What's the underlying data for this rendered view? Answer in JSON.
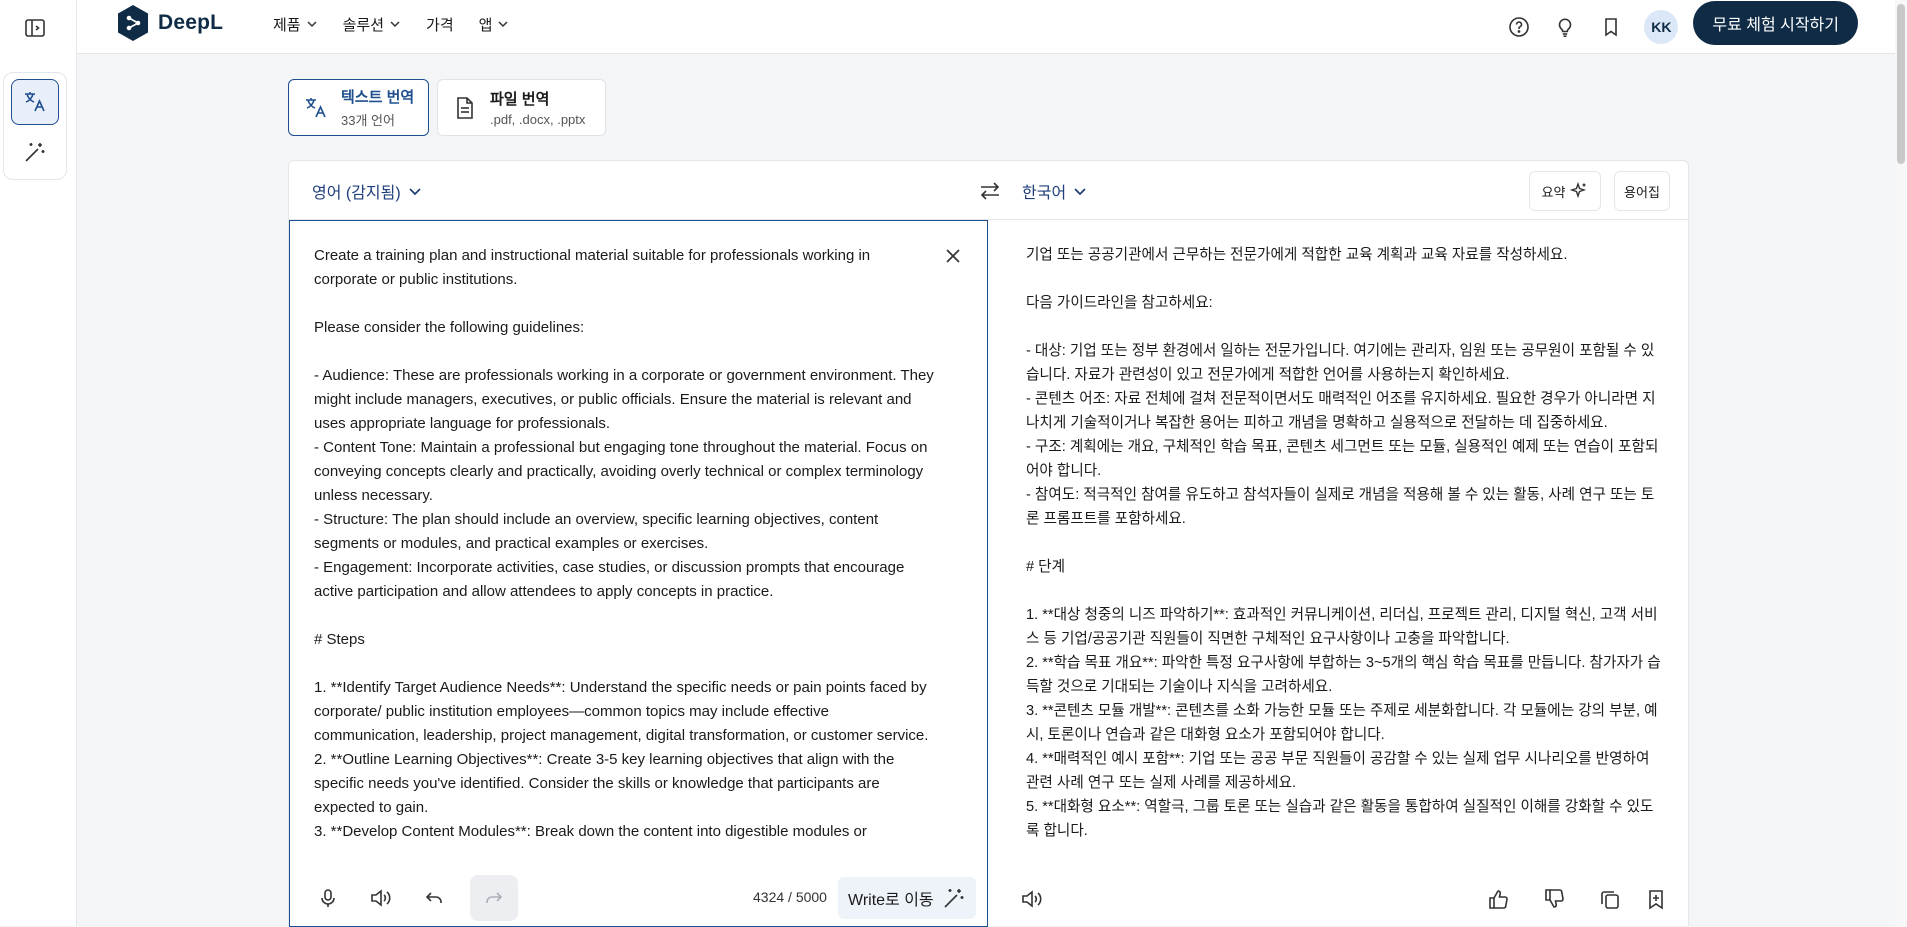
{
  "app": {
    "name": "DeepL"
  },
  "nav": {
    "items": [
      {
        "label": "제품",
        "dropdown": true
      },
      {
        "label": "솔루션",
        "dropdown": true
      },
      {
        "label": "가격",
        "dropdown": false
      },
      {
        "label": "앱",
        "dropdown": true
      }
    ]
  },
  "header": {
    "avatar_initials": "KK",
    "trial_button": "무료 체험 시작하기"
  },
  "modes": {
    "text": {
      "title": "텍스트 번역",
      "subtitle": "33개 언어"
    },
    "file": {
      "title": "파일 번역",
      "subtitle": ".pdf, .docx, .pptx"
    }
  },
  "languages": {
    "source": "영어 (감지됨)",
    "target": "한국어"
  },
  "tools": {
    "summary": "요약",
    "glossary": "용어집"
  },
  "source": {
    "text": "Create a training plan and instructional material suitable for professionals working in corporate or public institutions.\n\nPlease consider the following guidelines:\n\n- Audience: These are professionals working in a corporate or government environment. They might include managers, executives, or public officials. Ensure the material is relevant and uses appropriate language for professionals.\n- Content Tone: Maintain a professional but engaging tone throughout the material. Focus on conveying concepts clearly and practically, avoiding overly technical or complex terminology unless necessary.\n- Structure: The plan should include an overview, specific learning objectives, content segments or modules, and practical examples or exercises.\n- Engagement: Incorporate activities, case studies, or discussion prompts that encourage active participation and allow attendees to apply concepts in practice.\n\n# Steps\n\n1. **Identify Target Audience Needs**: Understand the specific needs or pain points faced by corporate/ public institution employees—common topics may include effective communication, leadership, project management, digital transformation, or customer service.\n2. **Outline Learning Objectives**: Create 3-5 key learning objectives that align with the specific needs you've identified. Consider the skills or knowledge that participants are expected to gain.\n3. **Develop Content Modules**: Break down the content into digestible modules or",
    "counter": "4324 / 5000",
    "write_button": "Write로 이동"
  },
  "target": {
    "text": "기업 또는 공공기관에서 근무하는 전문가에게 적합한 교육 계획과 교육 자료를 작성하세요.\n\n다음 가이드라인을 참고하세요:\n\n- 대상: 기업 또는 정부 환경에서 일하는 전문가입니다. 여기에는 관리자, 임원 또는 공무원이 포함될 수 있습니다. 자료가 관련성이 있고 전문가에게 적합한 언어를 사용하는지 확인하세요.\n- 콘텐츠 어조: 자료 전체에 걸쳐 전문적이면서도 매력적인 어조를 유지하세요. 필요한 경우가 아니라면 지나치게 기술적이거나 복잡한 용어는 피하고 개념을 명확하고 실용적으로 전달하는 데 집중하세요.\n- 구조: 계획에는 개요, 구체적인 학습 목표, 콘텐츠 세그먼트 또는 모듈, 실용적인 예제 또는 연습이 포함되어야 합니다.\n- 참여도: 적극적인 참여를 유도하고 참석자들이 실제로 개념을 적용해 볼 수 있는 활동, 사례 연구 또는 토론 프롬프트를 포함하세요.\n\n# 단계\n\n1. **대상 청중의 니즈 파악하기**: 효과적인 커뮤니케이션, 리더십, 프로젝트 관리, 디지털 혁신, 고객 서비스 등 기업/공공기관 직원들이 직면한 구체적인 요구사항이나 고충을 파악합니다.\n2. **학습 목표 개요**: 파악한 특정 요구사항에 부합하는 3~5개의 핵심 학습 목표를 만듭니다. 참가자가 습득할 것으로 기대되는 기술이나 지식을 고려하세요.\n3. **콘텐츠 모듈 개발**: 콘텐츠를 소화 가능한 모듈 또는 주제로 세분화합니다. 각 모듈에는 강의 부분, 예시, 토론이나 연습과 같은 대화형 요소가 포함되어야 합니다.\n4. **매력적인 예시 포함**: 기업 또는 공공 부문 직원들이 공감할 수 있는 실제 업무 시나리오를 반영하여 관련 사례 연구 또는 실제 사례를 제공하세요.\n5. **대화형 요소**: 역할극, 그룹 토론 또는 실습과 같은 활동을 통합하여 실질적인 이해를 강화할 수 있도록 합니다."
  },
  "colors": {
    "brand_dark": "#0f2b46",
    "accent_blue": "#1f4f8f",
    "link_blue": "#1f3e7a"
  }
}
